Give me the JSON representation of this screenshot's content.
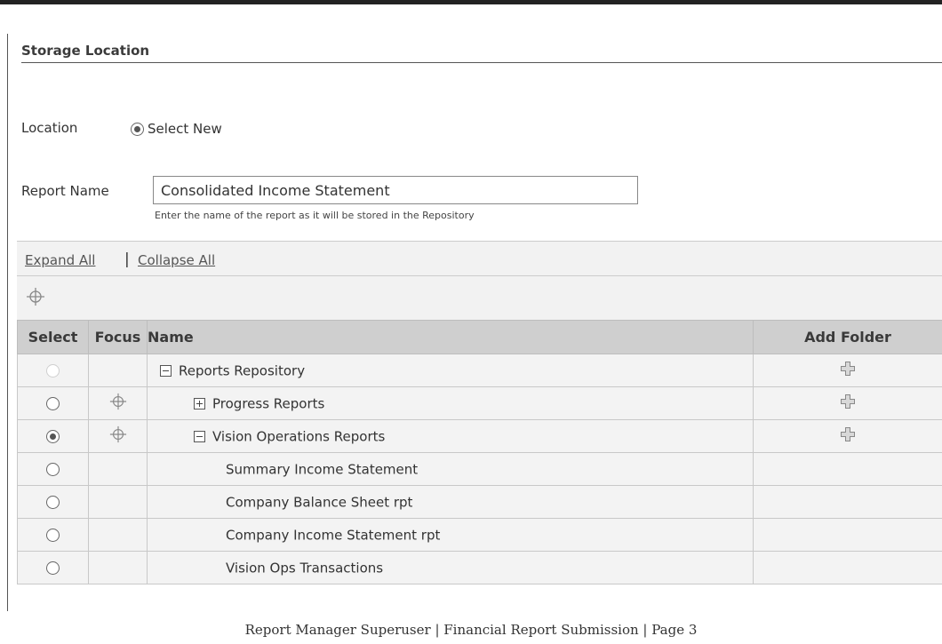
{
  "section": {
    "title": "Storage Location"
  },
  "location": {
    "label": "Location",
    "option_label": "Select New",
    "selected": true
  },
  "report_name": {
    "label": "Report Name",
    "value": "Consolidated Income Statement",
    "hint": "Enter the name of the report as it will be stored in the Repository"
  },
  "toolbar": {
    "expand_all": "Expand All",
    "collapse_all": "Collapse All",
    "separator": "|"
  },
  "table": {
    "headers": {
      "select": "Select",
      "focus": "Focus",
      "name": "Name",
      "add_folder": "Add Folder"
    },
    "rows": [
      {
        "name": "Reports Repository",
        "level": 0,
        "expander": "minus",
        "selected": false,
        "select_disabled": true,
        "focus": false,
        "add_folder": true
      },
      {
        "name": "Progress Reports",
        "level": 1,
        "expander": "plus",
        "selected": false,
        "select_disabled": false,
        "focus": true,
        "add_folder": true
      },
      {
        "name": "Vision Operations Reports",
        "level": 1,
        "expander": "minus",
        "selected": true,
        "select_disabled": false,
        "focus": true,
        "add_folder": true
      },
      {
        "name": "Summary Income Statement",
        "level": 2,
        "expander": "none",
        "selected": false,
        "select_disabled": false,
        "focus": false,
        "add_folder": false
      },
      {
        "name": "Company Balance Sheet rpt",
        "level": 2,
        "expander": "none",
        "selected": false,
        "select_disabled": false,
        "focus": false,
        "add_folder": false
      },
      {
        "name": "Company Income Statement rpt",
        "level": 2,
        "expander": "none",
        "selected": false,
        "select_disabled": false,
        "focus": false,
        "add_folder": false
      },
      {
        "name": "Vision Ops Transactions",
        "level": 2,
        "expander": "none",
        "selected": false,
        "select_disabled": false,
        "focus": false,
        "add_folder": false
      }
    ]
  },
  "icons": {
    "focus": "crosshair-focus-icon",
    "add_folder": "plus-add-folder-icon",
    "expand": "plus-box-icon",
    "collapse": "minus-box-icon"
  },
  "footer": {
    "text": "Report Manager Superuser | Financial Report Submission | Page 3"
  }
}
